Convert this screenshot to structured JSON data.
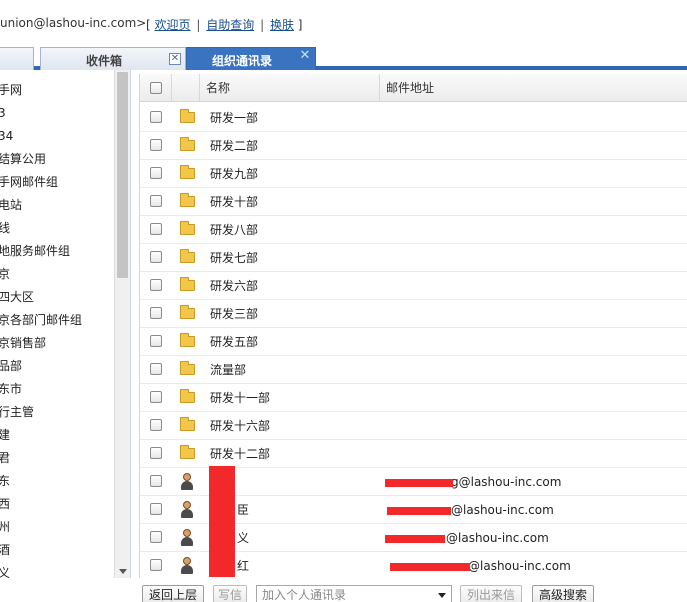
{
  "header": {
    "email": "union@lashou-inc.com>",
    "bracket_open": "[",
    "bracket_close": "]",
    "sep": "|",
    "links": [
      "欢迎页",
      "自助查询",
      "换肤"
    ]
  },
  "tabs": [
    {
      "label": "",
      "close": "✕",
      "active": false
    },
    {
      "label": "收件箱",
      "close": "✕",
      "active": false
    },
    {
      "label": "组织通讯录",
      "close": "✕",
      "active": true
    }
  ],
  "sidebar": {
    "items": [
      "手网",
      "3",
      "34",
      "结算公用",
      "手网邮件组",
      "电站",
      "线",
      "地服务邮件组",
      "京",
      "四大区",
      "京各部门邮件组",
      "京销售部",
      "品部",
      "东市",
      "行主管",
      "建",
      "君",
      "东",
      "西",
      "州",
      "酒",
      "义"
    ]
  },
  "table": {
    "headers": {
      "name": "名称",
      "email": "邮件地址"
    },
    "folders": [
      "研发一部",
      "研发二部",
      "研发九部",
      "研发十部",
      "研发八部",
      "研发七部",
      "研发六部",
      "研发三部",
      "研发五部",
      "流量部",
      "研发十一部",
      "研发十六部",
      "研发十二部"
    ],
    "contacts": [
      {
        "name": "",
        "email": "g@lashou-inc.com"
      },
      {
        "name": "臣",
        "email": "@lashou-inc.com"
      },
      {
        "name": "义",
        "email": "@lashou-inc.com"
      },
      {
        "name": "红",
        "email": "@lashou-inc.com"
      }
    ]
  },
  "toolbar": {
    "back": "返回上层",
    "write": "写信",
    "add_placeholder": "加入个人通讯录",
    "export": "列出来信",
    "search": "高级搜索"
  },
  "colors": {
    "accent": "#2f67b3",
    "link": "#1a4f8b",
    "redaction": "#f2282b"
  }
}
